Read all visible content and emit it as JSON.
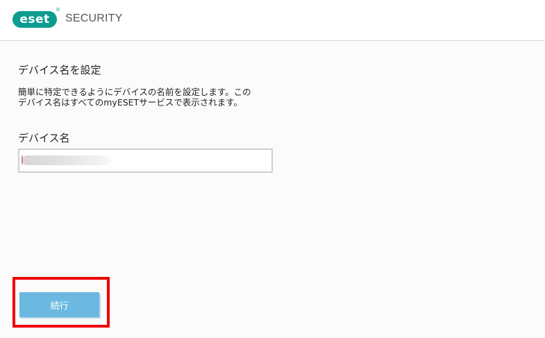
{
  "header": {
    "logo_text": "eset",
    "logo_mark": "®",
    "product_name": "SECURITY"
  },
  "main": {
    "title": "デバイス名を設定",
    "description_lines": [
      "簡単に特定できるようにデバイスの名前を設定します。この",
      "デバイス名はすべてのmyESETサービスで表示されます。"
    ],
    "field_label": "デバイス名",
    "field_value": ""
  },
  "footer": {
    "continue_label": "続行"
  },
  "colors": {
    "brand": "#0e9c91",
    "button": "#6bb8e0",
    "highlight": "#ee0000"
  },
  "icons": [
    "eset-logo-icon"
  ]
}
